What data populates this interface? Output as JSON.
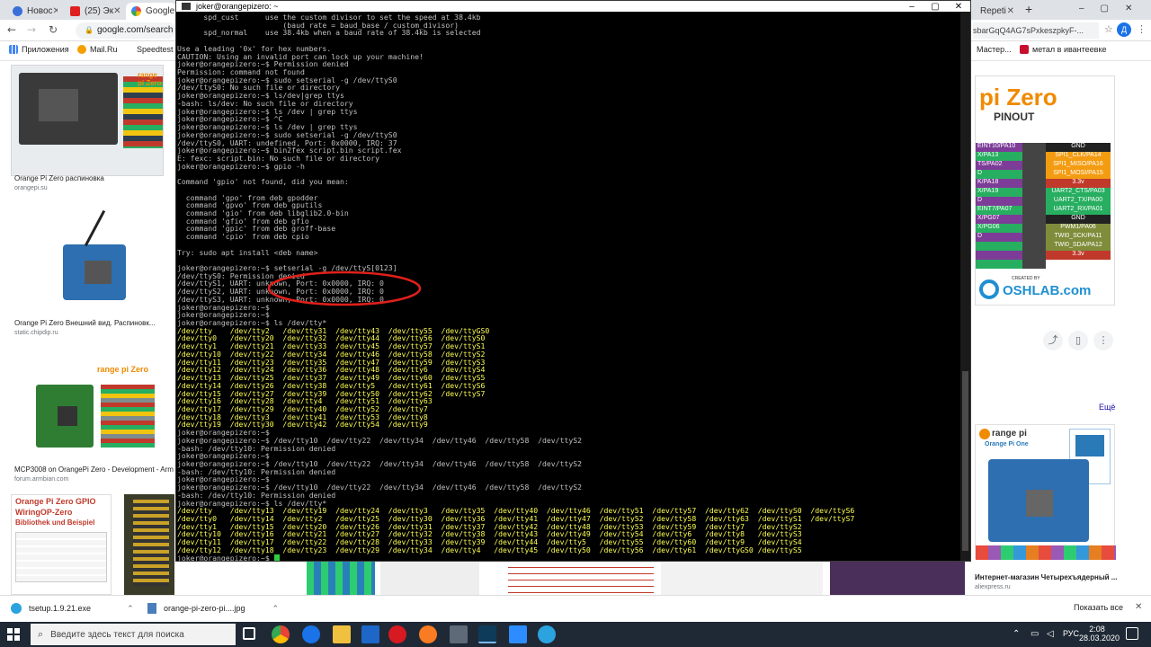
{
  "browser": {
    "tabs": [
      "Новос",
      "(25) Эк",
      "Google",
      "Repeti"
    ],
    "url": "google.com/search",
    "url_right": "sbarGqQ4AG7sPxkeszpkyF-..."
  },
  "bookmarks": [
    "Приложения",
    "Mail.Ru",
    "Speedtest",
    "Мастер...",
    "метал в ивантеевке"
  ],
  "left_results": [
    {
      "title": "Orange Pi Zero распиновка",
      "source": "orangepi.su"
    },
    {
      "title": "Orange Pi Zero Внешний вид. Распиновк...",
      "source": "static.chipdip.ru"
    },
    {
      "title": "MCP3008 on OrangePi Zero - Development - Arm",
      "source": "forum.armbian.com"
    }
  ],
  "left_bottom_card": {
    "line1": "Orange Pi Zero GPIO",
    "line2": "WiringOP-Zero",
    "line3": "Bibliothek und Beispiel"
  },
  "right_panel": {
    "pinout_title": "pi Zero",
    "pinout_sub": "PINOUT",
    "pins_left": [
      "EINT10/PA10",
      "X/PA13",
      "TS/PA02",
      "D",
      "K/PA18",
      "X/PA19",
      "D",
      "EINT7/PA07",
      "X/PG07",
      "X/PG06",
      "D",
      "",
      "",
      ""
    ],
    "pins_right": [
      "GND",
      "SPI1_CLK/PA14",
      "SPI1_MISO/PA16",
      "SPI1_MOSI/PA15",
      "3.3v",
      "UART2_CTS/PA03",
      "UART2_TX/PA00",
      "UART2_RX/PA01",
      "GND",
      "PWM1/PA06",
      "TWI0_SCK/PA11",
      "TWI0_SDA/PA12",
      "3.3v"
    ],
    "created_by": "CREATED BY",
    "oshlab": "OSHLAB.com",
    "more": "Ещё",
    "product_brand": "range pi",
    "product_name": "Orange Pi One",
    "product_title": "Интернет-магазин Четырехъядерный ...",
    "product_source": "aliexpress.ru"
  },
  "terminal": {
    "title": "joker@orangepizero: ~",
    "lines": [
      {
        "t": "      spd_cust      use the custom divisor to set the speed at 38.4kb",
        "c": "n"
      },
      {
        "t": "                        (baud rate = baud_base / custom_divisor)",
        "c": "n"
      },
      {
        "t": "      spd_normal    use 38.4kb when a baud rate of 38.4kb is selected",
        "c": "n"
      },
      {
        "t": "",
        "c": "n"
      },
      {
        "t": "Use a leading '0x' for hex numbers.",
        "c": "n"
      },
      {
        "t": "CAUTION: Using an invalid port can lock up your machine!",
        "c": "n"
      },
      {
        "t": "joker@orangepizero:~$ Permission denied",
        "c": "n"
      },
      {
        "t": "Permission: command not found",
        "c": "n"
      },
      {
        "t": "joker@orangepizero:~$ sudo setserial -g /dev/ttyS0",
        "c": "n"
      },
      {
        "t": "/dev/ttyS0: No such file or directory",
        "c": "n"
      },
      {
        "t": "joker@orangepizero:~$ ls/dev|grep ttys",
        "c": "n"
      },
      {
        "t": "-bash: ls/dev: No such file or directory",
        "c": "n"
      },
      {
        "t": "joker@orangepizero:~$ ls /dev | grep ttys",
        "c": "n"
      },
      {
        "t": "joker@orangepizero:~$ ^C",
        "c": "n"
      },
      {
        "t": "joker@orangepizero:~$ ls /dev | grep ttys",
        "c": "n"
      },
      {
        "t": "joker@orangepizero:~$ sudo setserial -g /dev/ttyS0",
        "c": "n"
      },
      {
        "t": "/dev/ttyS0, UART: undefined, Port: 0x0000, IRQ: 37",
        "c": "n"
      },
      {
        "t": "joker@orangepizero:~$ bin2fex script.bin script.fex",
        "c": "n"
      },
      {
        "t": "E: fexc: script.bin: No such file or directory",
        "c": "n"
      },
      {
        "t": "joker@orangepizero:~$ gpio -h",
        "c": "n"
      },
      {
        "t": "",
        "c": "n"
      },
      {
        "t": "Command 'gpio' not found, did you mean:",
        "c": "n"
      },
      {
        "t": "",
        "c": "n"
      },
      {
        "t": "  command 'gpo' from deb gpodder",
        "c": "n"
      },
      {
        "t": "  command 'gpvo' from deb gputils",
        "c": "n"
      },
      {
        "t": "  command 'gio' from deb libglib2.0-bin",
        "c": "n"
      },
      {
        "t": "  command 'gfio' from deb gfio",
        "c": "n"
      },
      {
        "t": "  command 'gpic' from deb groff-base",
        "c": "n"
      },
      {
        "t": "  command 'cpio' from deb cpio",
        "c": "n"
      },
      {
        "t": "",
        "c": "n"
      },
      {
        "t": "Try: sudo apt install <deb name>",
        "c": "n"
      },
      {
        "t": "",
        "c": "n"
      },
      {
        "t": "joker@orangepizero:~$ setserial -g /dev/ttyS[0123]",
        "c": "n"
      },
      {
        "t": "/dev/ttyS0: Permission denied",
        "c": "n"
      },
      {
        "t": "/dev/ttyS1, UART: unknown, Port: 0x0000, IRQ: 0",
        "c": "n"
      },
      {
        "t": "/dev/ttyS2, UART: unknown, Port: 0x0000, IRQ: 0",
        "c": "n"
      },
      {
        "t": "/dev/ttyS3, UART: unknown, Port: 0x0000, IRQ: 0",
        "c": "n"
      },
      {
        "t": "joker@orangepizero:~$",
        "c": "n"
      },
      {
        "t": "joker@orangepizero:~$",
        "c": "n"
      },
      {
        "t": "joker@orangepizero:~$ ls /dev/tty*",
        "c": "n"
      },
      {
        "t": "/dev/tty    /dev/tty2   /dev/tty31  /dev/tty43  /dev/tty55  /dev/ttyGS0",
        "c": "y"
      },
      {
        "t": "/dev/tty0   /dev/tty20  /dev/tty32  /dev/tty44  /dev/tty56  /dev/ttyS0",
        "c": "y"
      },
      {
        "t": "/dev/tty1   /dev/tty21  /dev/tty33  /dev/tty45  /dev/tty57  /dev/ttyS1",
        "c": "y"
      },
      {
        "t": "/dev/tty10  /dev/tty22  /dev/tty34  /dev/tty46  /dev/tty58  /dev/ttyS2",
        "c": "y"
      },
      {
        "t": "/dev/tty11  /dev/tty23  /dev/tty35  /dev/tty47  /dev/tty59  /dev/ttyS3",
        "c": "y"
      },
      {
        "t": "/dev/tty12  /dev/tty24  /dev/tty36  /dev/tty48  /dev/tty6   /dev/ttyS4",
        "c": "y"
      },
      {
        "t": "/dev/tty13  /dev/tty25  /dev/tty37  /dev/tty49  /dev/tty60  /dev/ttyS5",
        "c": "y"
      },
      {
        "t": "/dev/tty14  /dev/tty26  /dev/tty38  /dev/tty5   /dev/tty61  /dev/ttyS6",
        "c": "y"
      },
      {
        "t": "/dev/tty15  /dev/tty27  /dev/tty39  /dev/tty50  /dev/tty62  /dev/ttyS7",
        "c": "y"
      },
      {
        "t": "/dev/tty16  /dev/tty28  /dev/tty4   /dev/tty51  /dev/tty63",
        "c": "y"
      },
      {
        "t": "/dev/tty17  /dev/tty29  /dev/tty40  /dev/tty52  /dev/tty7",
        "c": "y"
      },
      {
        "t": "/dev/tty18  /dev/tty3   /dev/tty41  /dev/tty53  /dev/tty8",
        "c": "y"
      },
      {
        "t": "/dev/tty19  /dev/tty30  /dev/tty42  /dev/tty54  /dev/tty9",
        "c": "y"
      },
      {
        "t": "joker@orangepizero:~$",
        "c": "n"
      },
      {
        "t": "joker@orangepizero:~$ /dev/tty10  /dev/tty22  /dev/tty34  /dev/tty46  /dev/tty58  /dev/ttyS2",
        "c": "n"
      },
      {
        "t": "-bash: /dev/tty10: Permission denied",
        "c": "n"
      },
      {
        "t": "joker@orangepizero:~$",
        "c": "n"
      },
      {
        "t": "joker@orangepizero:~$ /dev/tty10  /dev/tty22  /dev/tty34  /dev/tty46  /dev/tty58  /dev/ttyS2",
        "c": "n"
      },
      {
        "t": "-bash: /dev/tty10: Permission denied",
        "c": "n"
      },
      {
        "t": "joker@orangepizero:~$",
        "c": "n"
      },
      {
        "t": "joker@orangepizero:~$ /dev/tty10  /dev/tty22  /dev/tty34  /dev/tty46  /dev/tty58  /dev/ttyS2",
        "c": "n"
      },
      {
        "t": "-bash: /dev/tty10: Permission denied",
        "c": "n"
      },
      {
        "t": "joker@orangepizero:~$ ls /dev/tty*",
        "c": "n"
      },
      {
        "t": "/dev/tty    /dev/tty13  /dev/tty19  /dev/tty24  /dev/tty3   /dev/tty35  /dev/tty40  /dev/tty46  /dev/tty51  /dev/tty57  /dev/tty62  /dev/ttyS0  /dev/ttyS6",
        "c": "y"
      },
      {
        "t": "/dev/tty0   /dev/tty14  /dev/tty2   /dev/tty25  /dev/tty30  /dev/tty36  /dev/tty41  /dev/tty47  /dev/tty52  /dev/tty58  /dev/tty63  /dev/ttyS1  /dev/ttyS7",
        "c": "y"
      },
      {
        "t": "/dev/tty1   /dev/tty15  /dev/tty20  /dev/tty26  /dev/tty31  /dev/tty37  /dev/tty42  /dev/tty48  /dev/tty53  /dev/tty59  /dev/tty7   /dev/ttyS2",
        "c": "y"
      },
      {
        "t": "/dev/tty10  /dev/tty16  /dev/tty21  /dev/tty27  /dev/tty32  /dev/tty38  /dev/tty43  /dev/tty49  /dev/tty54  /dev/tty6   /dev/tty8   /dev/ttyS3",
        "c": "y"
      },
      {
        "t": "/dev/tty11  /dev/tty17  /dev/tty22  /dev/tty28  /dev/tty33  /dev/tty39  /dev/tty44  /dev/tty5   /dev/tty55  /dev/tty60  /dev/tty9   /dev/ttyS4",
        "c": "y"
      },
      {
        "t": "/dev/tty12  /dev/tty18  /dev/tty23  /dev/tty29  /dev/tty34  /dev/tty4   /dev/tty45  /dev/tty50  /dev/tty56  /dev/tty61  /dev/ttyGS0 /dev/ttyS5",
        "c": "y"
      },
      {
        "t": "joker@orangepizero:~$ ",
        "c": "n"
      }
    ]
  },
  "downloads": [
    {
      "name": "tsetup.1.9.21.exe"
    },
    {
      "name": "orange-pi-zero-pi....jpg"
    }
  ],
  "downloads_show_all": "Показать все",
  "taskbar": {
    "search_placeholder": "Введите здесь текст для поиска",
    "lang": "РУС",
    "time": "2:08",
    "date": "28.03.2020"
  },
  "colors": {
    "terminal_bg": "#000000",
    "terminal_text": "#c0c0c0",
    "terminal_highlight": "#ffff54",
    "annotation": "#e0201a",
    "taskbar": "#1f2935"
  }
}
